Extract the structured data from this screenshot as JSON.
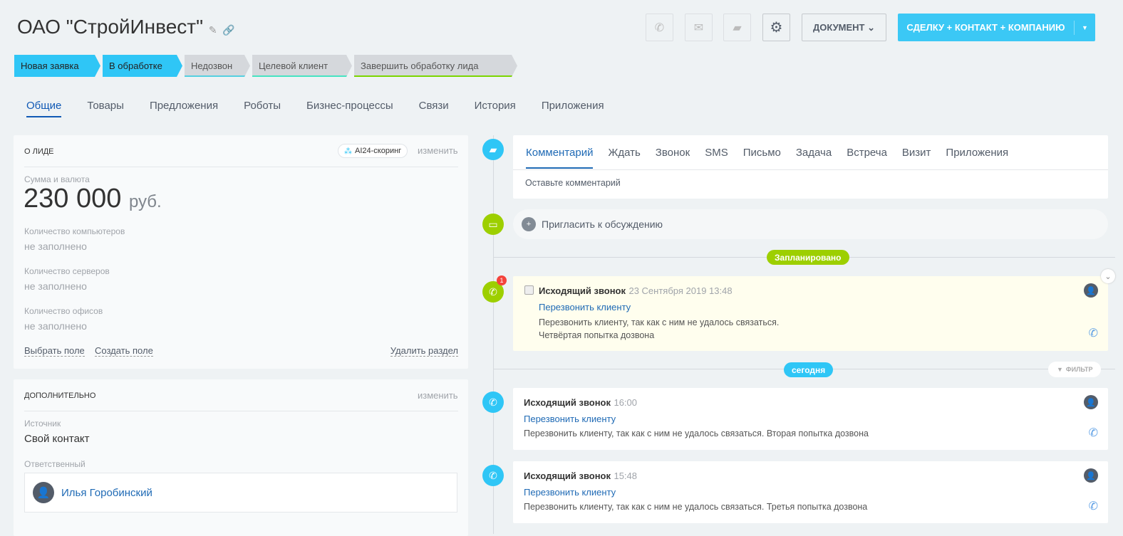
{
  "header": {
    "title": "ОАО \"СтройИнвест\"",
    "document_label": "ДОКУМЕНТ",
    "convert_label": "СДЕЛКУ + КОНТАКТ + КОМПАНИЮ"
  },
  "stages": [
    {
      "label": "Новая заявка",
      "active": true
    },
    {
      "label": "В обработке",
      "active": true
    },
    {
      "label": "Недозвон",
      "color": "#55d0e0"
    },
    {
      "label": "Целевой клиент",
      "color": "#47e4c2"
    },
    {
      "label": "Завершить обработку лида",
      "color": "#7bd500"
    }
  ],
  "tabs": [
    "Общие",
    "Товары",
    "Предложения",
    "Роботы",
    "Бизнес-процессы",
    "Связи",
    "История",
    "Приложения"
  ],
  "about": {
    "title": "О лиде",
    "scoring": "AI24-скоринг",
    "edit": "изменить",
    "amount_label": "Сумма и валюта",
    "amount": "230 000",
    "currency": "руб.",
    "fields": [
      {
        "label": "Количество компьютеров",
        "value": "не заполнено"
      },
      {
        "label": "Количество серверов",
        "value": "не заполнено"
      },
      {
        "label": "Количество офисов",
        "value": "не заполнено"
      }
    ],
    "select_field": "Выбрать поле",
    "create_field": "Создать поле",
    "delete_section": "Удалить раздел"
  },
  "extra": {
    "title": "Дополнительно",
    "edit": "изменить",
    "source_label": "Источник",
    "source": "Свой контакт",
    "responsible_label": "Ответственный",
    "responsible": "Илья Горобинский"
  },
  "activity": {
    "tabs": [
      "Комментарий",
      "Ждать",
      "Звонок",
      "SMS",
      "Письмо",
      "Задача",
      "Встреча",
      "Визит",
      "Приложения"
    ],
    "placeholder": "Оставьте комментарий",
    "invite": "Пригласить к обсуждению"
  },
  "timeline": {
    "planned": "Запланировано",
    "today": "сегодня",
    "filter": "ФИЛЬТР",
    "scheduled": {
      "badge": "1",
      "title": "Исходящий звонок",
      "time": "23 Сентября 2019 13:48",
      "link": "Перезвонить клиенту",
      "text1": "Перезвонить клиенту, так как с ним не удалось связаться.",
      "text2": "Четвёртая попытка дозвона"
    },
    "events": [
      {
        "title": "Исходящий звонок",
        "time": "16:00",
        "link": "Перезвонить клиенту",
        "text": "Перезвонить клиенту, так как с ним не удалось связаться. Вторая попытка дозвона"
      },
      {
        "title": "Исходящий звонок",
        "time": "15:48",
        "link": "Перезвонить клиенту",
        "text": "Перезвонить клиенту, так как с ним не удалось связаться. Третья попытка дозвона"
      }
    ]
  },
  "colors": {
    "accent": "#3bc8f5",
    "green": "#9dcf00",
    "link": "#1f6ab5"
  }
}
